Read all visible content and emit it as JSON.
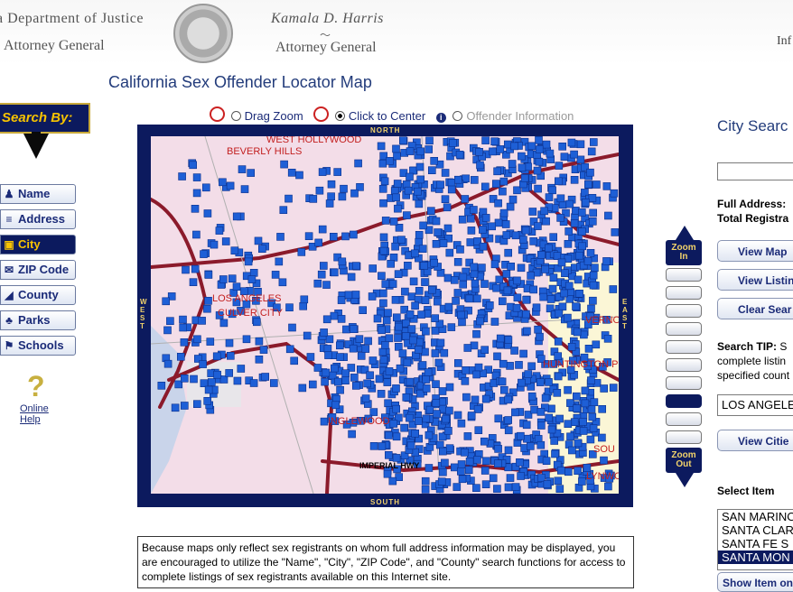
{
  "header": {
    "department": "a Department of Justice",
    "attorney_general_left": "Attorney General",
    "name": "Kamala D. Harris",
    "attorney_general_right": "Attorney General",
    "right_fragment": "Inf"
  },
  "title": "California Sex Offender Locator Map",
  "search_by": {
    "label": "Search By:",
    "items": [
      {
        "label": "Name",
        "icon": "person-icon"
      },
      {
        "label": "Address",
        "icon": "list-icon"
      },
      {
        "label": "City",
        "icon": "city-icon",
        "active": true
      },
      {
        "label": "ZIP Code",
        "icon": "envelope-icon"
      },
      {
        "label": "County",
        "icon": "county-icon"
      },
      {
        "label": "Parks",
        "icon": "tree-icon"
      },
      {
        "label": "Schools",
        "icon": "school-icon"
      }
    ]
  },
  "help": {
    "line1": "Online",
    "line2": "Help"
  },
  "map_controls": {
    "drag_zoom": "Drag Zoom",
    "click_to_center": "Click to Center",
    "offender_information": "Offender Information",
    "selected": "Click to Center"
  },
  "map": {
    "compass": {
      "north": "NORTH",
      "south": "SOUTH",
      "east": "EAST",
      "west": "WEST"
    },
    "places": [
      "WEST HOLLYWOOD",
      "BEVERLY HILLS",
      "LOS ANGELES",
      "CULVER CITY",
      "VERNON",
      "HUNTINGTON P",
      "INGLEWOOD",
      "IMPERIAL HWY",
      "SOU",
      "LYNWO"
    ],
    "colors": {
      "land": "#f3dde8",
      "marker": "#1e5fd6",
      "road": "#8b1a2b",
      "frame": "#0c1a5e"
    }
  },
  "zoom": {
    "in_line1": "Zoom",
    "in_line2": "In",
    "out_line1": "Zoom",
    "out_line2": "Out",
    "levels": 10,
    "selected_level": 8
  },
  "city_search": {
    "title": "City Searc",
    "input_value": "",
    "full_address_label": "Full Address:",
    "total_label": "Total Registra",
    "view_map": "View Map",
    "view_listing": "View Listin",
    "clear_search": "Clear Sear",
    "tip_label": "Search TIP:",
    "tip_line1": " S",
    "tip_line2": "complete listin",
    "tip_line3": "specified count",
    "county_value": "LOS ANGELE",
    "view_cities": "View Citie",
    "select_item_label": "Select Item",
    "items": [
      "SAN MARINO",
      "SANTA CLAR",
      "SANTA FE S",
      "SANTA MON"
    ],
    "selected_item": "SANTA MON",
    "show_item": "Show Item on"
  },
  "disclaimer": "Because maps only reflect sex registrants on whom full address information may be displayed, you are encouraged to utilize the \"Name\", \"City\", \"ZIP Code\", and \"County\" search functions for access to complete listings of sex registrants available on this Internet site."
}
